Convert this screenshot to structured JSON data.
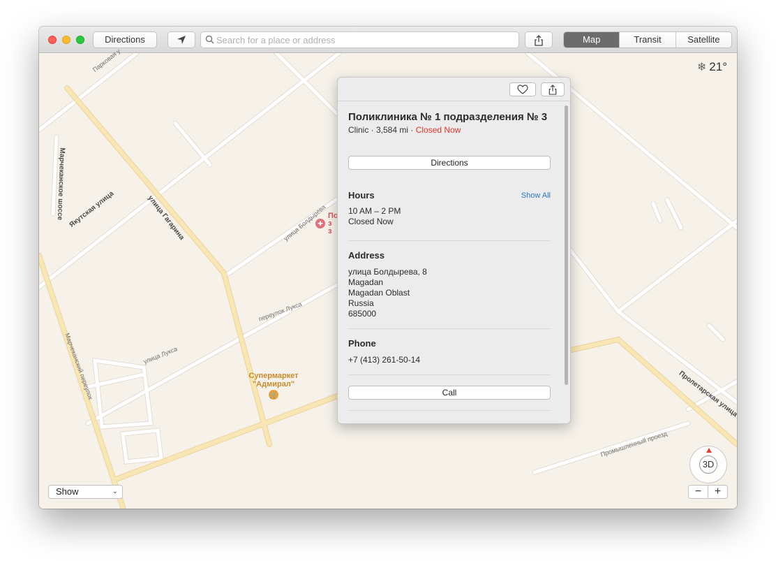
{
  "toolbar": {
    "directions_label": "Directions",
    "search_placeholder": "Search for a place or address",
    "map_modes": [
      "Map",
      "Transit",
      "Satellite"
    ],
    "active_mode": "Map"
  },
  "map": {
    "weather": {
      "icon": "snowflake-icon",
      "temperature": "21°"
    },
    "streets": {
      "parkovaya": "Парковая у",
      "yakutskaya": "Якутская улица",
      "gagarina": "улица Гагарина",
      "boldyreva": "улица Болдырева",
      "luksa_lane": "переулок Лукса",
      "luksa_street": "улица Лукса",
      "marchekanskoe": "Марчеканское шоссе",
      "marchekansky": "Марчеканский переулок",
      "proletarskaya": "Пролетарская улица",
      "promyshlenny": "Промышленный проезд"
    },
    "poi_supermarket": {
      "line1": "Супермаркет",
      "line2": "\"Адмирал\""
    },
    "clinic_label": {
      "line1": "По",
      "line2": "з",
      "line3": "з"
    },
    "show_select": "Show",
    "compass_label": "3D",
    "zoom_out": "−",
    "zoom_in": "+"
  },
  "place": {
    "title": "Поликлиника № 1 подразделения № 3",
    "category_distance": "Clinic · 3,584 mi · ",
    "status": "Closed Now",
    "directions_label": "Directions",
    "hours_title": "Hours",
    "show_all": "Show All",
    "hours": "10 AM – 2 PM",
    "hours_status": "Closed Now",
    "address_title": "Address",
    "address_lines": [
      "улица Болдырева, 8",
      "Magadan",
      "Magadan Oblast",
      "Russia",
      "685000"
    ],
    "phone_title": "Phone",
    "phone": "+7 (413) 261-50-14",
    "call_label": "Call"
  },
  "colors": {
    "closed": "#e5332a",
    "link": "#2a76d2",
    "map_bg": "#f6f2ea",
    "major_road": "#f8e6b4"
  }
}
